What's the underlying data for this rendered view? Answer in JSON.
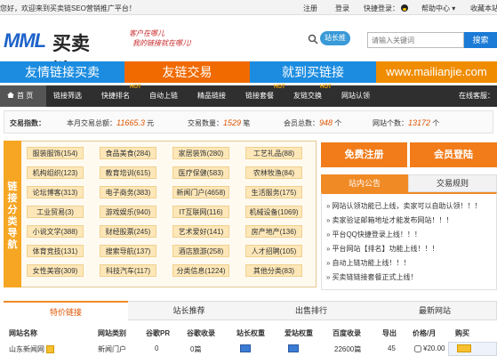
{
  "topbar": {
    "welcome": "您好，欢迎来到买卖链SEO营销推广平台！",
    "register": "注册",
    "login": "登录",
    "quick_login": "快捷登录：",
    "help_center": "帮助中心",
    "favorites": "收藏本站"
  },
  "header": {
    "logo_latin": "MML",
    "logo_cn": "买卖链",
    "slogan_line1": "客户在哪儿",
    "slogan_line2": "我的链接就在哪儿!",
    "badge": "站长推",
    "search_placeholder": "请输入关键词",
    "search_button": "搜索"
  },
  "banners": [
    "友情链接买卖",
    "友链交易",
    "就到买链接",
    "www.mailianjie.com"
  ],
  "nav": {
    "items": [
      {
        "label": "首 页",
        "hot": ""
      },
      {
        "label": "链接筛选",
        "hot": ""
      },
      {
        "label": "快捷排名",
        "hot": "HOT"
      },
      {
        "label": "自动上链",
        "hot": ""
      },
      {
        "label": "精品链接",
        "hot": ""
      },
      {
        "label": "链接套餐",
        "hot": "HOT"
      },
      {
        "label": "友链交换",
        "hot": "HOT"
      },
      {
        "label": "网站认领",
        "hot": ""
      }
    ],
    "service": "在线客服："
  },
  "stats": {
    "label": "交易指数：",
    "total_label": "本月交易总额：",
    "total_value": "11665.3",
    "total_unit": "元",
    "count_label": "交易数量：",
    "count_value": "1529",
    "count_unit": "笔",
    "members_label": "会员总数：",
    "members_value": "948",
    "members_unit": "个",
    "sites_label": "网站个数：",
    "sites_value": "13172",
    "sites_unit": "个"
  },
  "category_panel": {
    "side_title": "链接分类导航",
    "categories": [
      "服装服饰(154)",
      "食品美食(284)",
      "家居装饰(280)",
      "工艺礼品(88)",
      "机构组织(123)",
      "教育培训(615)",
      "医疗保健(583)",
      "农林牧渔(84)",
      "论坛博客(313)",
      "电子商务(383)",
      "新闻门户(4658)",
      "生活服务(175)",
      "工业贸易(3)",
      "游戏娱乐(940)",
      "IT互联网(116)",
      "机械设备(1069)",
      "小说文学(388)",
      "财经股票(245)",
      "艺术爱好(141)",
      "房产地产(136)",
      "体育竞技(131)",
      "搜索导航(137)",
      "酒店旅游(258)",
      "人才招聘(105)",
      "女性美容(309)",
      "科技汽车(117)",
      "分类信息(1224)",
      "其他分类(83)"
    ]
  },
  "account": {
    "register_button": "免费注册",
    "login_button": "会员登陆"
  },
  "notice_tabs": {
    "notice": "站内公告",
    "rules": "交易规则"
  },
  "notices": [
    "网站认领功能已上线，卖家可以自助认领！！！",
    "卖家验证邮箱地址才能发布网站！！！",
    "平台QQ快捷登录上线！！！",
    "平台网站【排名】功能上线！！！",
    "自动上链功能上线！！！",
    "买卖链链接套餐正式上线！"
  ],
  "bottom_tabs": [
    "特价链接",
    "站长推荐",
    "出售排行",
    "最新网站"
  ],
  "table": {
    "headers": [
      "网站名称",
      "网站类别",
      "谷歌PR",
      "谷歌收录",
      "站长权重",
      "爱站权重",
      "百度收录",
      "导出",
      "价格/月",
      "购买"
    ],
    "rows": [
      {
        "name": "山东新闻网",
        "category": "新闻门户",
        "pr": "0",
        "google_index": "0篇",
        "baidu_index": "22600篇",
        "export": "45",
        "price": "¥20.00"
      }
    ]
  },
  "colors": {
    "accent_orange": "#f08a24",
    "brand_blue": "#1d63c9",
    "nav_dark": "#2f2f2f",
    "highlight": "#e05400"
  }
}
